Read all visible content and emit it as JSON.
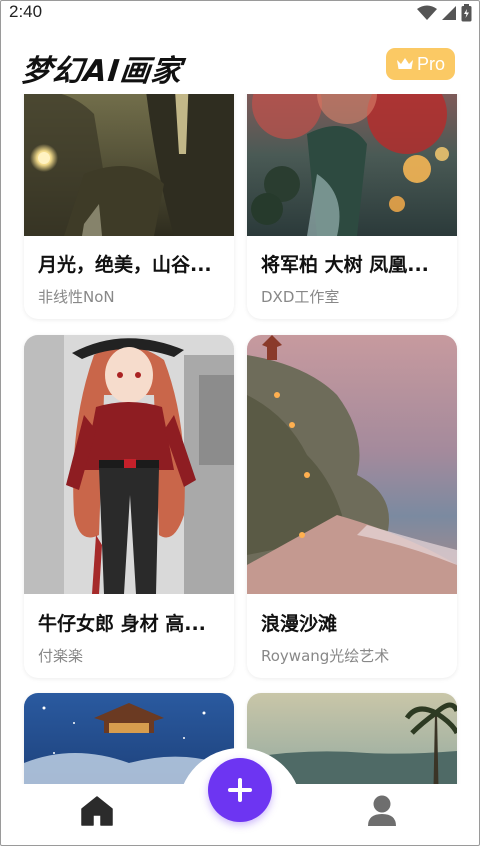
{
  "status_bar": {
    "time": "2:40"
  },
  "header": {
    "app_title": "梦幻AI画家",
    "pro_label": "Pro"
  },
  "cards": [
    {
      "title": "月光，绝美，山谷...",
      "author": "非线性NoN"
    },
    {
      "title": "将军柏 大树 凤凰...",
      "author": "DXD工作室"
    },
    {
      "title": "牛仔女郎 身材 高...",
      "author": "付楽楽"
    },
    {
      "title": "浪漫沙滩",
      "author": "Roywang光绘艺术"
    }
  ],
  "nav": {
    "home_icon": "home-icon",
    "create_icon": "plus-icon",
    "profile_icon": "person-icon"
  },
  "colors": {
    "accent": "#6d35f2",
    "pro": "#fbc964"
  }
}
